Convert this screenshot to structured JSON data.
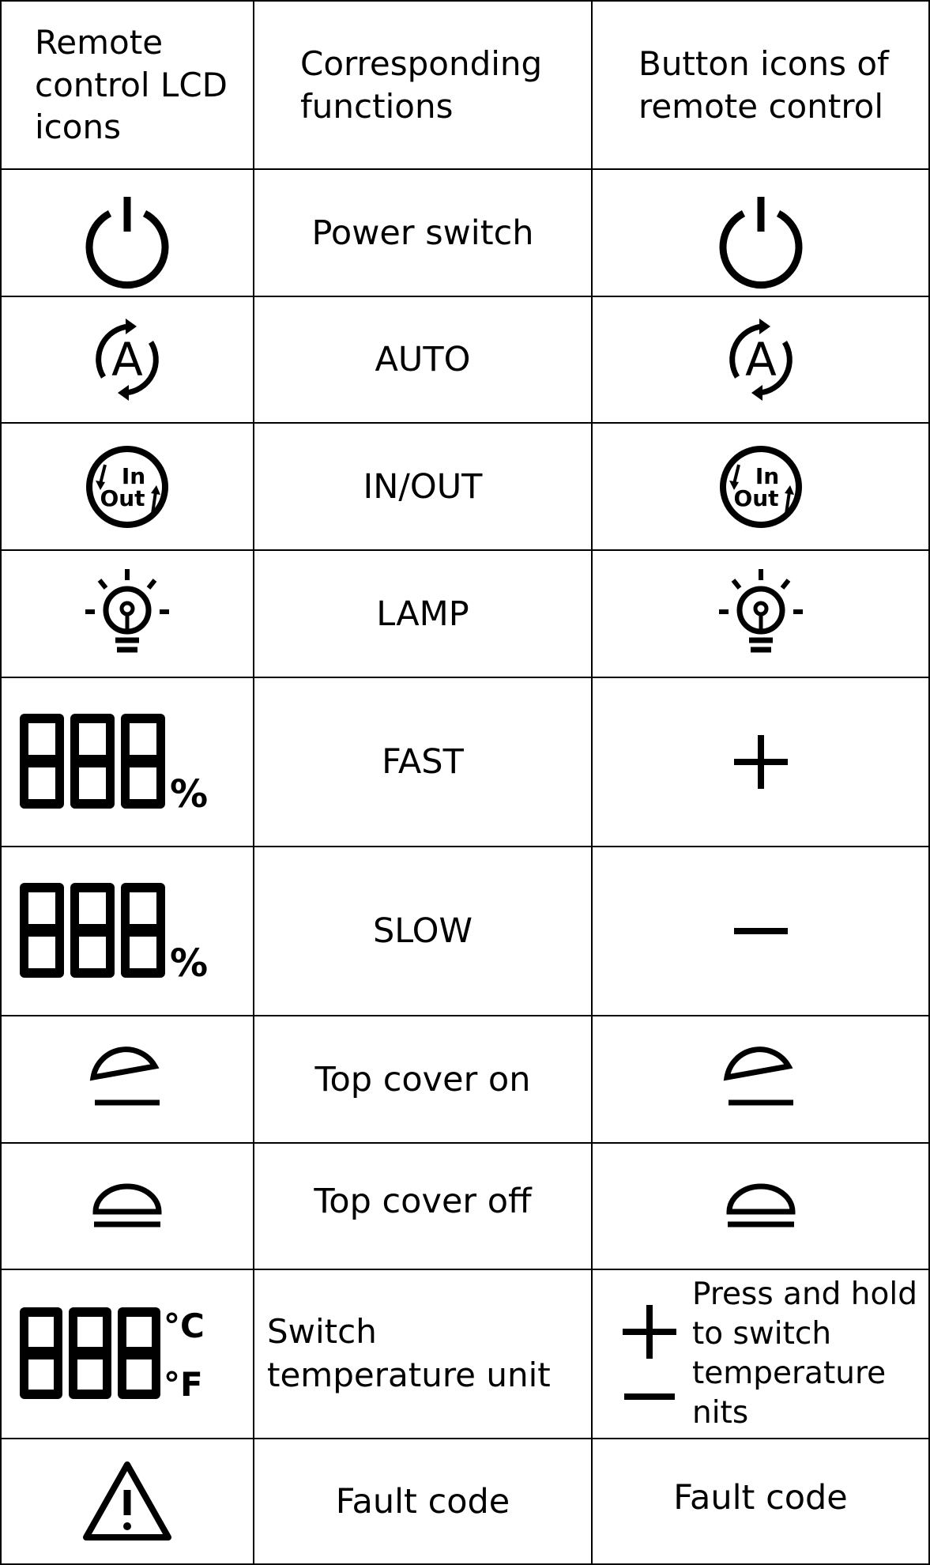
{
  "headers": {
    "col1": "Remote control LCD icons",
    "col2": "Corresponding functions",
    "col3": "Button icons of remote control"
  },
  "rows": [
    {
      "lcd_icon": "power-icon",
      "function": "Power switch",
      "button_icon": "power-icon"
    },
    {
      "lcd_icon": "auto-icon",
      "function": "AUTO",
      "button_icon": "auto-icon"
    },
    {
      "lcd_icon": "in-out-icon",
      "function": "IN/OUT",
      "button_icon": "in-out-icon"
    },
    {
      "lcd_icon": "lamp-icon",
      "function": "LAMP",
      "button_icon": "lamp-icon"
    },
    {
      "lcd_icon": "seven-segment-percent-icon",
      "function": "FAST",
      "button_icon": "plus-icon"
    },
    {
      "lcd_icon": "seven-segment-percent-icon",
      "function": "SLOW",
      "button_icon": "minus-icon"
    },
    {
      "lcd_icon": "cover-open-icon",
      "function": "Top cover on",
      "button_icon": "cover-open-icon"
    },
    {
      "lcd_icon": "cover-closed-icon",
      "function": "Top cover off",
      "button_icon": "cover-closed-icon"
    },
    {
      "lcd_icon": "seven-segment-temperature-icon",
      "function": "Switch temperature unit",
      "button_icon": "plus-minus-icon",
      "button_text": "Press and hold to switch temperature nits"
    },
    {
      "lcd_icon": "warning-icon",
      "function": "Fault code",
      "button_text": "Fault code"
    }
  ],
  "glyphs": {
    "percent": "%",
    "celsius": "°C",
    "fahrenheit": "°F",
    "auto_letter": "A",
    "in_label": "In",
    "out_label": "Out"
  }
}
